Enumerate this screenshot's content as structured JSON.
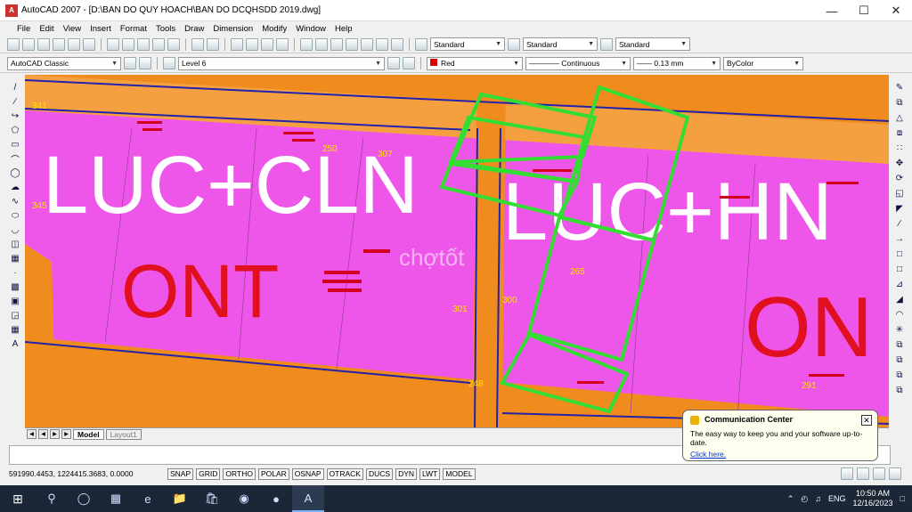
{
  "window": {
    "title": "AutoCAD 2007 - [D:\\BAN DO QUY HOACH\\BAN DO DCQHSDD 2019.dwg]",
    "icon_label": "A"
  },
  "menu": [
    "File",
    "Edit",
    "View",
    "Insert",
    "Format",
    "Tools",
    "Draw",
    "Dimension",
    "Modify",
    "Window",
    "Help"
  ],
  "toolbar1": {
    "text_style": "Standard",
    "dim_style": "Standard",
    "table_style": "Standard"
  },
  "toolbar2": {
    "workspace": "AutoCAD Classic",
    "layer": "Level 6",
    "color": "Red",
    "linetype": "Continuous",
    "lineweight": "0.13 mm",
    "plotstyle": "ByColor"
  },
  "canvas": {
    "big_labels": [
      "LUC+CLN",
      "LUC+HN",
      "ONT",
      "ON"
    ],
    "parcel_numbers": [
      "341",
      "345",
      "301",
      "300",
      "265",
      "248",
      "250",
      "307",
      "291"
    ],
    "watermark": "chợtốt"
  },
  "layout_tabs": {
    "model": "Model",
    "layout1": "Layout1"
  },
  "status": {
    "coords": "591990.4453, 1224415.3683, 0.0000",
    "buttons": [
      "SNAP",
      "GRID",
      "ORTHO",
      "POLAR",
      "OSNAP",
      "OTRACK",
      "DUCS",
      "DYN",
      "LWT",
      "MODEL"
    ]
  },
  "bubble": {
    "title": "Communication Center",
    "text": "The easy way to keep you and your software up-to-date.",
    "link": "Click here."
  },
  "taskbar": {
    "lang": "ENG",
    "time": "10:50 AM",
    "date": "12/16/2023"
  },
  "colors": {
    "canvas_pink": "#ee56ea",
    "road_orange": "#f08c1e",
    "boundary_green": "#33dd33",
    "ont_red": "#e01020"
  }
}
